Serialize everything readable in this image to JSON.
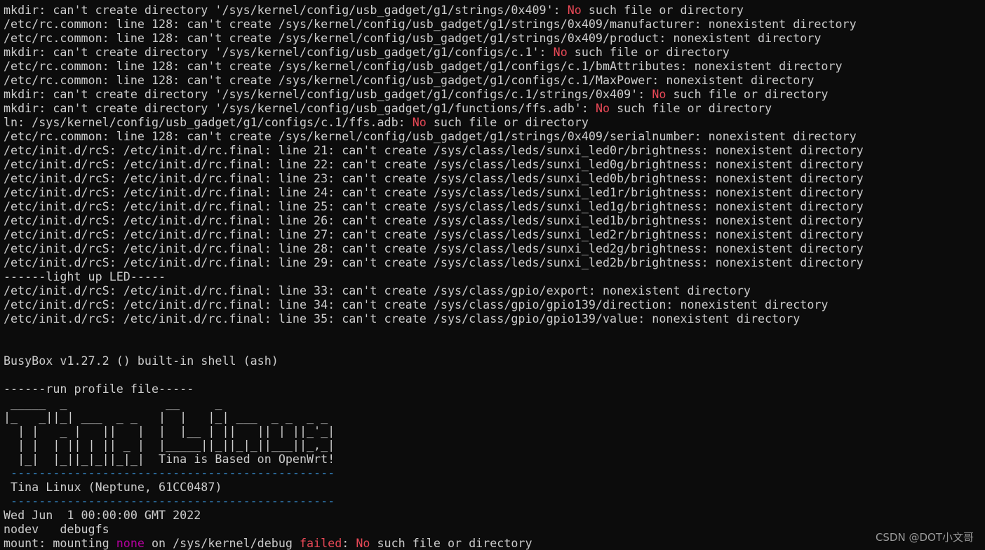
{
  "colors": {
    "background": "#0c0c0c",
    "text": "#cccccc",
    "red": "#e74856",
    "blue": "#3a96dd",
    "magenta": "#b4009e"
  },
  "terminal": {
    "lines": [
      [
        {
          "t": "mkdir: can't create directory '/sys/kernel/config/usb_gadget/g1/strings/0x409': "
        },
        {
          "t": "No",
          "c": "red"
        },
        {
          "t": " such file or directory"
        }
      ],
      [
        {
          "t": "/etc/rc.common: line 128: can't create /sys/kernel/config/usb_gadget/g1/strings/0x409/manufacturer: nonexistent directory"
        }
      ],
      [
        {
          "t": "/etc/rc.common: line 128: can't create /sys/kernel/config/usb_gadget/g1/strings/0x409/product: nonexistent directory"
        }
      ],
      [
        {
          "t": "mkdir: can't create directory '/sys/kernel/config/usb_gadget/g1/configs/c.1': "
        },
        {
          "t": "No",
          "c": "red"
        },
        {
          "t": " such file or directory"
        }
      ],
      [
        {
          "t": "/etc/rc.common: line 128: can't create /sys/kernel/config/usb_gadget/g1/configs/c.1/bmAttributes: nonexistent directory"
        }
      ],
      [
        {
          "t": "/etc/rc.common: line 128: can't create /sys/kernel/config/usb_gadget/g1/configs/c.1/MaxPower: nonexistent directory"
        }
      ],
      [
        {
          "t": "mkdir: can't create directory '/sys/kernel/config/usb_gadget/g1/configs/c.1/strings/0x409': "
        },
        {
          "t": "No",
          "c": "red"
        },
        {
          "t": " such file or directory"
        }
      ],
      [
        {
          "t": "mkdir: can't create directory '/sys/kernel/config/usb_gadget/g1/functions/ffs.adb': "
        },
        {
          "t": "No",
          "c": "red"
        },
        {
          "t": " such file or directory"
        }
      ],
      [
        {
          "t": "ln: /sys/kernel/config/usb_gadget/g1/configs/c.1/ffs.adb: "
        },
        {
          "t": "No",
          "c": "red"
        },
        {
          "t": " such file or directory"
        }
      ],
      [
        {
          "t": "/etc/rc.common: line 128: can't create /sys/kernel/config/usb_gadget/g1/strings/0x409/serialnumber: nonexistent directory"
        }
      ],
      [
        {
          "t": "/etc/init.d/rcS: /etc/init.d/rc.final: line 21: can't create /sys/class/leds/sunxi_led0r/brightness: nonexistent directory"
        }
      ],
      [
        {
          "t": "/etc/init.d/rcS: /etc/init.d/rc.final: line 22: can't create /sys/class/leds/sunxi_led0g/brightness: nonexistent directory"
        }
      ],
      [
        {
          "t": "/etc/init.d/rcS: /etc/init.d/rc.final: line 23: can't create /sys/class/leds/sunxi_led0b/brightness: nonexistent directory"
        }
      ],
      [
        {
          "t": "/etc/init.d/rcS: /etc/init.d/rc.final: line 24: can't create /sys/class/leds/sunxi_led1r/brightness: nonexistent directory"
        }
      ],
      [
        {
          "t": "/etc/init.d/rcS: /etc/init.d/rc.final: line 25: can't create /sys/class/leds/sunxi_led1g/brightness: nonexistent directory"
        }
      ],
      [
        {
          "t": "/etc/init.d/rcS: /etc/init.d/rc.final: line 26: can't create /sys/class/leds/sunxi_led1b/brightness: nonexistent directory"
        }
      ],
      [
        {
          "t": "/etc/init.d/rcS: /etc/init.d/rc.final: line 27: can't create /sys/class/leds/sunxi_led2r/brightness: nonexistent directory"
        }
      ],
      [
        {
          "t": "/etc/init.d/rcS: /etc/init.d/rc.final: line 28: can't create /sys/class/leds/sunxi_led2g/brightness: nonexistent directory"
        }
      ],
      [
        {
          "t": "/etc/init.d/rcS: /etc/init.d/rc.final: line 29: can't create /sys/class/leds/sunxi_led2b/brightness: nonexistent directory"
        }
      ],
      [
        {
          "t": "------light up LED-----"
        }
      ],
      [
        {
          "t": "/etc/init.d/rcS: /etc/init.d/rc.final: line 33: can't create /sys/class/gpio/export: nonexistent directory"
        }
      ],
      [
        {
          "t": "/etc/init.d/rcS: /etc/init.d/rc.final: line 34: can't create /sys/class/gpio/gpio139/direction: nonexistent directory"
        }
      ],
      [
        {
          "t": "/etc/init.d/rcS: /etc/init.d/rc.final: line 35: can't create /sys/class/gpio/gpio139/value: nonexistent directory"
        }
      ],
      [
        {
          "t": ""
        }
      ],
      [
        {
          "t": ""
        }
      ],
      [
        {
          "t": "BusyBox v1.27.2 () built-in shell (ash)"
        }
      ],
      [
        {
          "t": ""
        }
      ],
      [
        {
          "t": "------run profile file-----"
        }
      ],
      [
        {
          "t": " _____  _              __     _"
        }
      ],
      [
        {
          "t": "|_   _||_| ___  _ _   |  |   |_| ___  _ _  _ _"
        }
      ],
      [
        {
          "t": "  | |   _ |   ||   |  |  |__ | ||   || | ||_'_|"
        }
      ],
      [
        {
          "t": "  | |  | || | || _ |  |_____||_||_|_||___||_,_|"
        }
      ],
      [
        {
          "t": "  |_|  |_||_|_||_|_|  Tina is Based on OpenWrt!"
        }
      ],
      [
        {
          "t": " ----------------------------------------------",
          "c": "blue"
        }
      ],
      [
        {
          "t": " Tina Linux (Neptune, 61CC0487)"
        }
      ],
      [
        {
          "t": " ----------------------------------------------",
          "c": "blue"
        }
      ],
      [
        {
          "t": "Wed Jun  1 00:00:00 GMT 2022"
        }
      ],
      [
        {
          "t": "nodev   debugfs"
        }
      ],
      [
        {
          "t": "mount: mounting "
        },
        {
          "t": "none",
          "c": "magenta"
        },
        {
          "t": " on /sys/kernel/debug "
        },
        {
          "t": "failed",
          "c": "red"
        },
        {
          "t": ": "
        },
        {
          "t": "No",
          "c": "red"
        },
        {
          "t": " such file or directory"
        }
      ]
    ]
  },
  "watermark": {
    "text": "CSDN @DOT小文哥"
  }
}
